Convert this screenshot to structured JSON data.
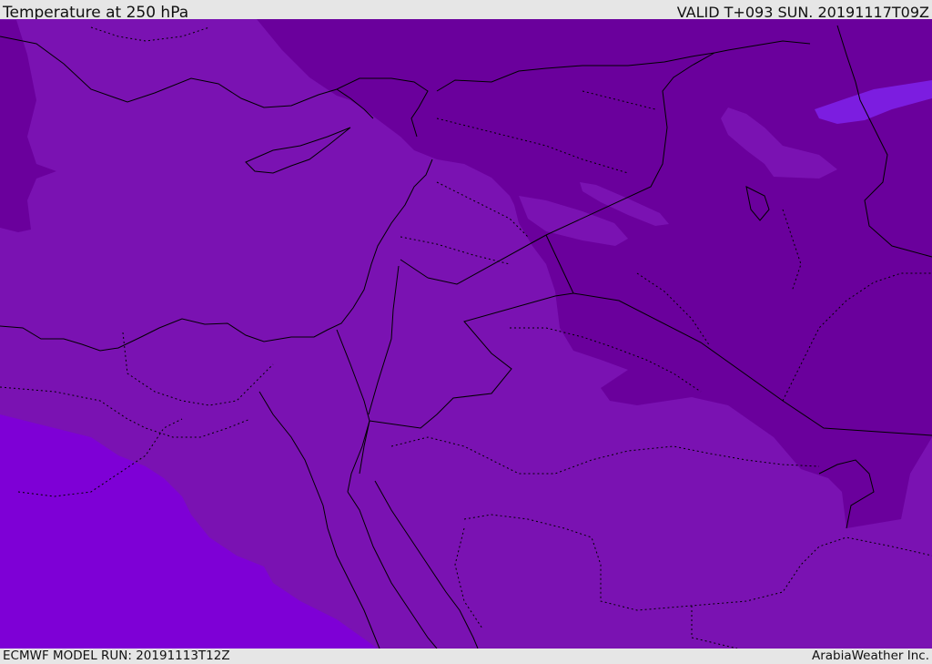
{
  "header": {
    "title": "Temperature at 250 hPa",
    "valid": "VALID T+093 SUN. 20191117T09Z"
  },
  "footer": {
    "model_run": "ECMWF MODEL RUN: 20191113T12Z",
    "credit": "ArabiaWeather Inc."
  },
  "map": {
    "colors": {
      "base": "#7a12b2",
      "cold": "#6a009c",
      "warm": "#7e00d6",
      "warm_patch": "#7c1de0",
      "border": "#000000"
    }
  }
}
